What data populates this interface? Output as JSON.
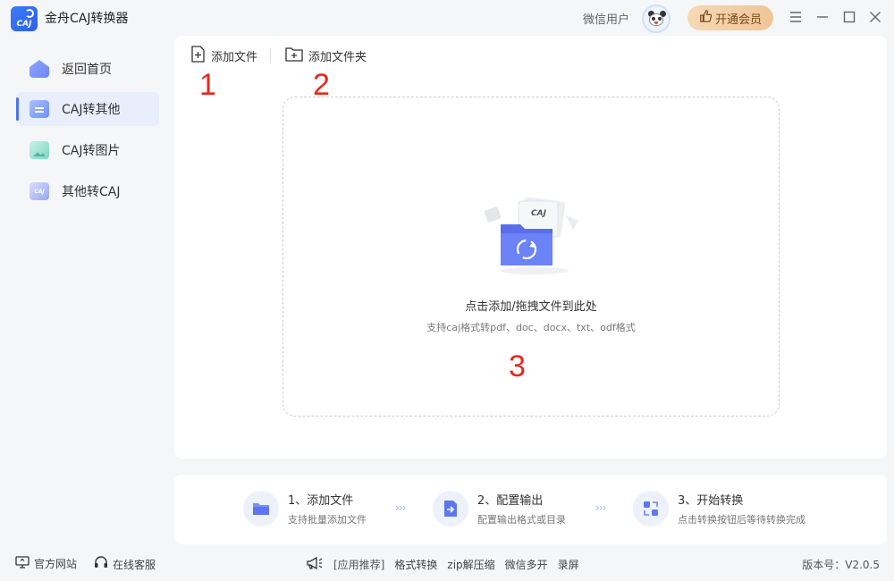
{
  "app": {
    "title": "金舟CAJ转换器",
    "logo_text": "CAJ"
  },
  "header": {
    "user_name": "微信用户",
    "vip_button": "开通会员"
  },
  "sidebar": {
    "items": [
      {
        "label": "返回首页"
      },
      {
        "label": "CAJ转其他",
        "active": true
      },
      {
        "label": "CAJ转图片"
      },
      {
        "label": "其他转CAJ"
      }
    ]
  },
  "toolbar": {
    "add_file": "添加文件",
    "add_folder": "添加文件夹"
  },
  "annotations": {
    "one": "1",
    "two": "2",
    "three": "3"
  },
  "dropzone": {
    "illus_label": "CAJ",
    "title": "点击添加/拖拽文件到此处",
    "subtitle": "支持caj格式转pdf、doc、docx、txt、odf格式"
  },
  "steps": [
    {
      "title": "1、添加文件",
      "desc": "支持批量添加文件"
    },
    {
      "title": "2、配置输出",
      "desc": "配置输出格式或目录"
    },
    {
      "title": "3、开始转换",
      "desc": "点击转换按钮后等待转换完成"
    }
  ],
  "step_arrow": "›››",
  "footer": {
    "official_site": "官方网站",
    "online_service": "在线客服",
    "recommend_label": "[应用推荐]",
    "recommend_links": [
      "格式转换",
      "zip解压缩",
      "微信多开",
      "录屏"
    ],
    "version": "版本号：V2.0.5"
  },
  "colors": {
    "accent": "#4a74f0",
    "annotation_red": "#e8281e",
    "vip_bg": "#efc597"
  }
}
